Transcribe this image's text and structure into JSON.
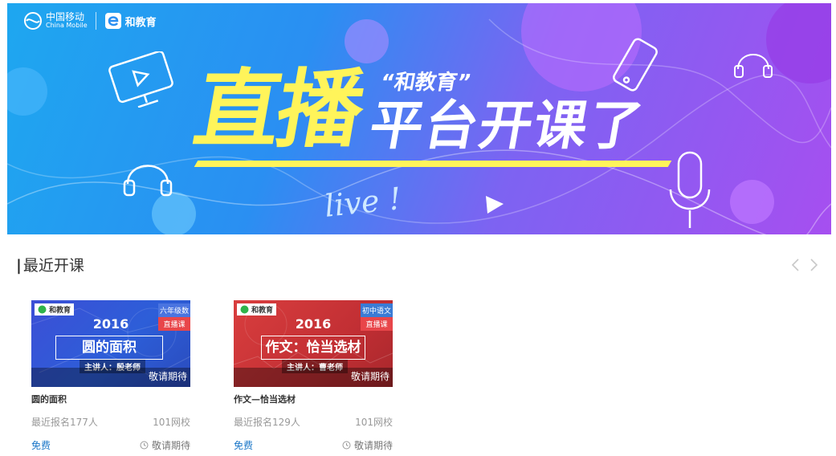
{
  "banner": {
    "brand_cn": "中国移动",
    "brand_en": "China Mobile",
    "product": "和教育",
    "headline_big": "直播",
    "headline_tag": "“和教育”",
    "headline_sub": "平台开课了",
    "live_text": "live !",
    "colors": {
      "yellow": "#fff45a",
      "blue": "#1ea7f0",
      "purple": "#a64ff0"
    }
  },
  "section": {
    "title": "最近开课",
    "bar": "|",
    "prev_icon": "chevron-left-icon",
    "next_icon": "chevron-right-icon"
  },
  "courses": [
    {
      "logo": "和教育",
      "grade": "六年级数学",
      "live_tag": "直播课",
      "year": "2016",
      "thumb_title": "圆的面积",
      "teacher": "主讲人：殷老师",
      "status": "敬请期待",
      "name": "圆的面积",
      "enrolled": "最近报名177人",
      "school": "101网校",
      "price": "免费",
      "wait": "敬请期待"
    },
    {
      "logo": "和教育",
      "grade": "初中语文",
      "live_tag": "直播课",
      "year": "2016",
      "thumb_title": "作文：恰当选材",
      "teacher": "主讲人：曹老师",
      "status": "敬请期待",
      "name": "作文—恰当选材",
      "enrolled": "最近报名129人",
      "school": "101网校",
      "price": "免费",
      "wait": "敬请期待"
    }
  ]
}
